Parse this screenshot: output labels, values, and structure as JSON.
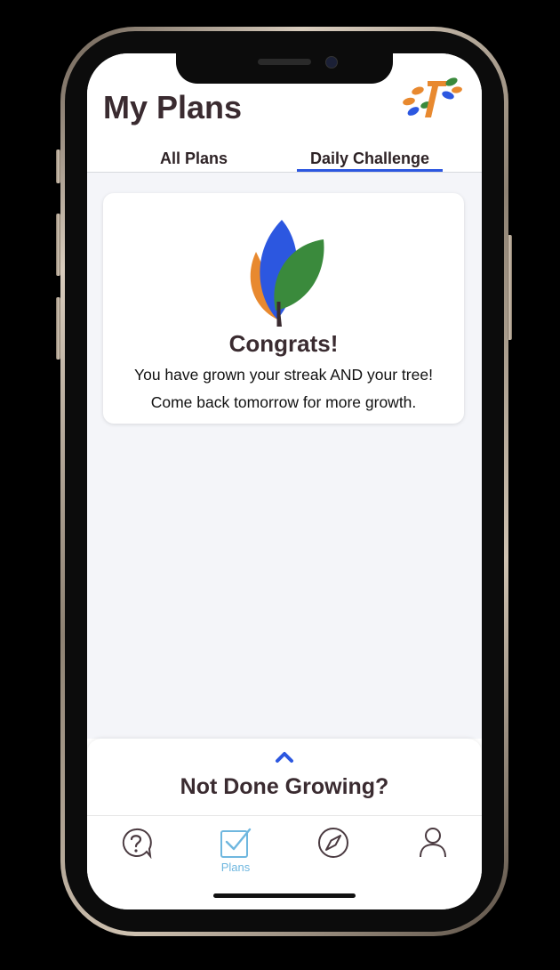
{
  "header": {
    "title": "My Plans",
    "logo_icon": "app-logo-icon"
  },
  "tabs": [
    {
      "label": "All Plans",
      "active": false
    },
    {
      "label": "Daily Challenge",
      "active": true
    }
  ],
  "card": {
    "icon": "tree-icon",
    "heading": "Congrats!",
    "line1": "You have grown your streak AND your tree!",
    "line2": "Come back tomorrow for more growth."
  },
  "bottom_sheet": {
    "icon": "chevron-up-icon",
    "title": "Not Done Growing?"
  },
  "nav": [
    {
      "icon": "help-chat-icon",
      "label": ""
    },
    {
      "icon": "checkbox-icon",
      "label": "Plans",
      "active": true
    },
    {
      "icon": "compass-icon",
      "label": ""
    },
    {
      "icon": "profile-icon",
      "label": ""
    }
  ],
  "colors": {
    "accent_blue": "#2c57e0",
    "leaf_green": "#3a8a3c",
    "leaf_orange": "#e8892f",
    "nav_active": "#6fb7df",
    "title_text": "#3a2b30",
    "content_bg": "#f4f5f9"
  }
}
